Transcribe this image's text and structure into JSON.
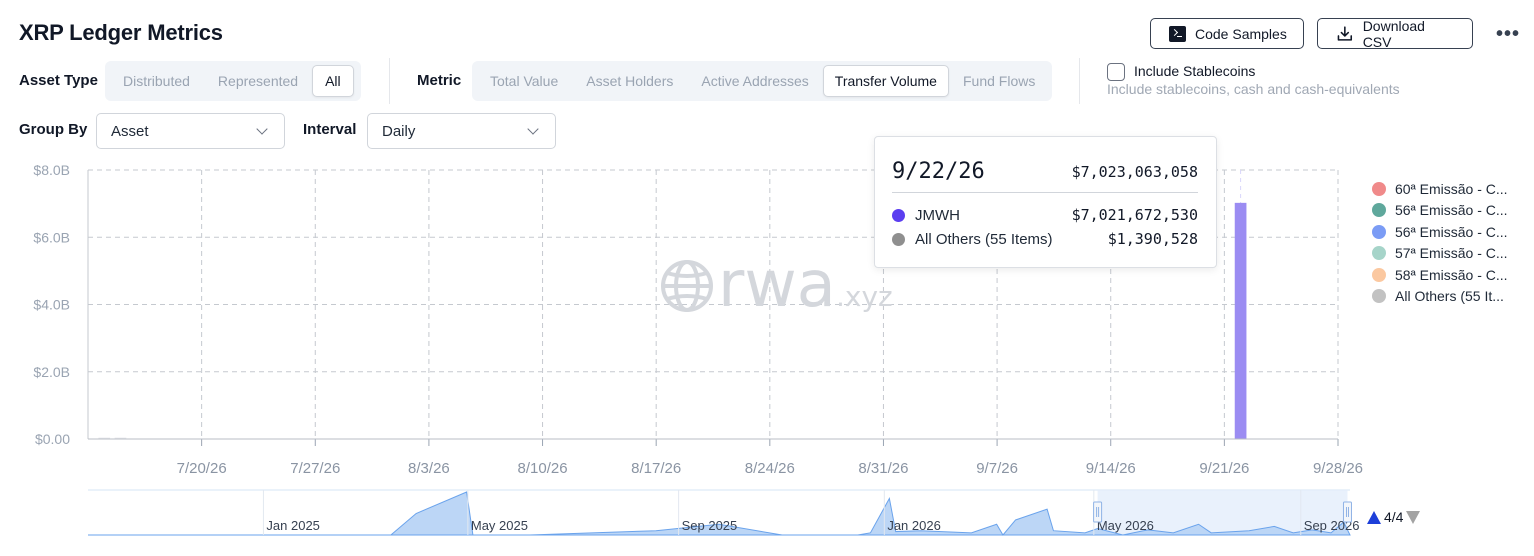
{
  "header": {
    "title": "XRP Ledger Metrics",
    "code_samples_label": "Code Samples",
    "download_csv_label": "Download CSV",
    "more_label": "•••"
  },
  "filters": {
    "asset_type_label": "Asset Type",
    "asset_type_options": [
      "Distributed",
      "Represented",
      "All"
    ],
    "asset_type_selected": "All",
    "metric_label": "Metric",
    "metric_options": [
      "Total Value",
      "Asset Holders",
      "Active Addresses",
      "Transfer Volume",
      "Fund Flows"
    ],
    "metric_selected": "Transfer Volume",
    "stablecoins_label": "Include Stablecoins",
    "stablecoins_sub": "Include stablecoins, cash and cash-equivalents",
    "stablecoins_checked": false,
    "group_by_label": "Group By",
    "group_by_value": "Asset",
    "interval_label": "Interval",
    "interval_value": "Daily"
  },
  "watermark": {
    "main": "rwa",
    "suffix": ".xyz"
  },
  "tooltip": {
    "date": "9/22/26",
    "total": "$7,023,063,058",
    "rows": [
      {
        "name": "JMWH",
        "value": "$7,021,672,530",
        "color": "#5b3ef0"
      },
      {
        "name": "All Others (55 Items)",
        "value": "$1,390,528",
        "color": "#8f8f8f"
      }
    ]
  },
  "legend": [
    {
      "label": "60ª Emissão - C...",
      "color": "#f08a8a"
    },
    {
      "label": "56ª Emissão - C...",
      "color": "#5fa89c"
    },
    {
      "label": "56ª Emissão - C...",
      "color": "#7b9cf5"
    },
    {
      "label": "57ª Emissão - C...",
      "color": "#a6d4c9"
    },
    {
      "label": "58ª Emissão - C...",
      "color": "#fbc8a0"
    },
    {
      "label": "All Others (55 It...",
      "color": "#c2c2c2"
    }
  ],
  "pager": {
    "text": "4/4"
  },
  "chart_data": {
    "type": "bar",
    "stacked": true,
    "x_type": "date",
    "ylim": [
      0,
      8000000000
    ],
    "yticks": [
      0,
      2000000000,
      4000000000,
      6000000000,
      8000000000
    ],
    "ytick_labels": [
      "$0.00",
      "$2.0B",
      "$4.0B",
      "$6.0B",
      "$8.0B"
    ],
    "xlim": [
      "2026-07-13",
      "2026-09-28"
    ],
    "xticks": [
      "2026-07-20",
      "2026-07-27",
      "2026-08-03",
      "2026-08-10",
      "2026-08-17",
      "2026-08-24",
      "2026-08-31",
      "2026-09-07",
      "2026-09-14",
      "2026-09-21",
      "2026-09-28"
    ],
    "xtick_labels": [
      "7/20/26",
      "7/27/26",
      "8/3/26",
      "8/10/26",
      "8/17/26",
      "8/24/26",
      "8/31/26",
      "9/7/26",
      "9/14/26",
      "9/21/26",
      "9/28/26"
    ],
    "grid": true,
    "legend_position": "right",
    "bar_color": "#9b8cf2",
    "x": [
      "2026-07-14",
      "2026-07-15",
      "2026-09-22"
    ],
    "series": [
      {
        "name": "JMWH",
        "values": [
          0,
          0,
          7021672530
        ]
      },
      {
        "name": "All Others (55 Items)",
        "values": [
          40000000,
          40000000,
          1390528
        ]
      }
    ],
    "navigator": {
      "tick_labels": [
        "Jan 2025",
        "May 2025",
        "Sep 2025",
        "Jan 2026",
        "May 2026",
        "Sep 2026"
      ],
      "series": [
        [
          0,
          0
        ],
        [
          0.02,
          0
        ],
        [
          0.03,
          0
        ],
        [
          0.24,
          0
        ],
        [
          0.26,
          0.5
        ],
        [
          0.3,
          1.0
        ],
        [
          0.305,
          0
        ],
        [
          0.35,
          0
        ],
        [
          0.45,
          0.1
        ],
        [
          0.5,
          0.25
        ],
        [
          0.55,
          0
        ],
        [
          0.61,
          0
        ],
        [
          0.62,
          0.05
        ],
        [
          0.635,
          0.85
        ],
        [
          0.64,
          0.08
        ],
        [
          0.66,
          0.1
        ],
        [
          0.7,
          0.05
        ],
        [
          0.72,
          0.25
        ],
        [
          0.725,
          0
        ],
        [
          0.735,
          0.35
        ],
        [
          0.76,
          0.6
        ],
        [
          0.765,
          0.1
        ],
        [
          0.79,
          0.05
        ],
        [
          0.8,
          0.15
        ],
        [
          0.82,
          0
        ],
        [
          0.84,
          0.12
        ],
        [
          0.86,
          0.05
        ],
        [
          0.88,
          0.25
        ],
        [
          0.89,
          0.05
        ],
        [
          0.92,
          0.1
        ],
        [
          0.94,
          0.2
        ],
        [
          0.955,
          0.05
        ],
        [
          0.97,
          0.12
        ],
        [
          0.985,
          0.05
        ],
        [
          0.995,
          0.3
        ],
        [
          1.0,
          0
        ]
      ],
      "window_start": 0.8,
      "window_end": 0.998
    }
  }
}
